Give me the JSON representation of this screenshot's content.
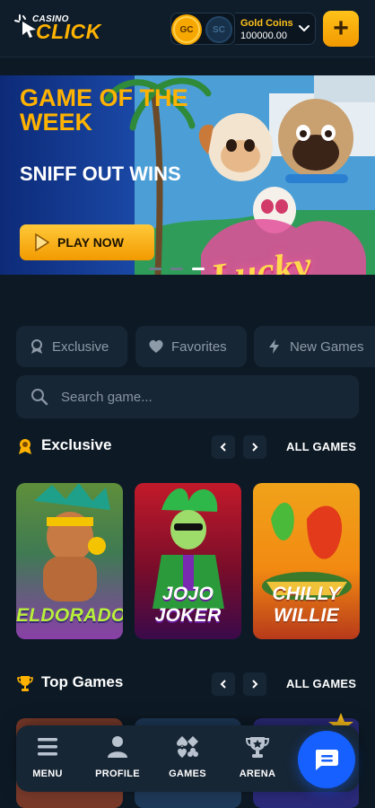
{
  "header": {
    "logo_small": "CASINO",
    "logo_big": "CLICK",
    "coin_gc": "GC",
    "coin_sc": "SC",
    "balance_label": "Gold Coins",
    "balance_value": "100000.00",
    "add_label": "+"
  },
  "banner": {
    "title": "GAME OF THE WEEK",
    "subtitle": "SNIFF OUT WINS",
    "play_label": "PLAY NOW",
    "game_logo": "Lucky Licks",
    "slides": 3,
    "active_slide": 3
  },
  "filters": {
    "exclusive": "Exclusive",
    "favorites": "Favorites",
    "new_games": "New Games"
  },
  "search": {
    "placeholder": "Search game..."
  },
  "exclusive_section": {
    "title": "Exclusive",
    "all_label": "ALL GAMES",
    "games": [
      "ELDORADO",
      "JOJO JOKER",
      "CHILLY WILLIE"
    ]
  },
  "top_section": {
    "title": "Top Games",
    "all_label": "ALL GAMES"
  },
  "bottom_nav": {
    "menu": "MENU",
    "profile": "PROFILE",
    "games": "GAMES",
    "arena": "ARENA"
  },
  "colors": {
    "background": "#0d1a26",
    "accent": "#ffb300",
    "chip_bg": "#172635",
    "chat_blue": "#1560ff"
  },
  "icons": {
    "logo": "cursor-sparkle-icon",
    "exclusive": "medal-icon",
    "favorites": "heart-icon",
    "new_games": "lightning-icon",
    "search": "search-icon",
    "top_games": "trophy-icon",
    "menu": "hamburger-icon",
    "profile": "user-icon",
    "games": "card-suits-icon",
    "arena": "arena-trophy-icon",
    "chat": "chat-bubble-icon"
  }
}
